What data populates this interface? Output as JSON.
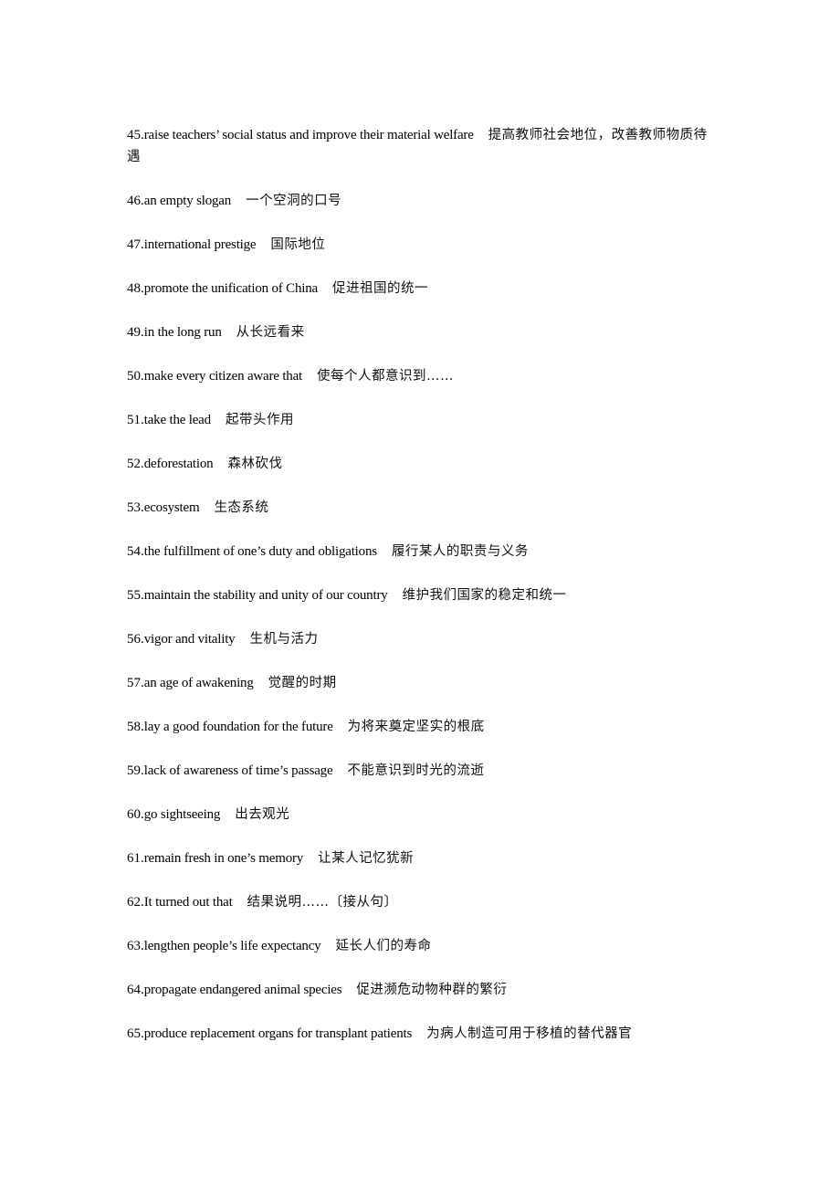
{
  "document": {
    "entries": [
      {
        "num": "45.",
        "en": "raise teachers’ social status and improve their material welfare",
        "zh": "提高教师社会地位，改善教师物质待遇"
      },
      {
        "num": "46.",
        "en": "an empty slogan",
        "zh": "一个空洞的口号"
      },
      {
        "num": "47.",
        "en": "international prestige",
        "zh": "国际地位"
      },
      {
        "num": "48.",
        "en": "promote the unification of China",
        "zh": "促进祖国的统一"
      },
      {
        "num": "49.",
        "en": "in the long run",
        "zh": "从长远看来"
      },
      {
        "num": "50.",
        "en": "make every citizen aware that",
        "zh": "使每个人都意识到……"
      },
      {
        "num": "51.",
        "en": "take the lead",
        "zh": "起带头作用"
      },
      {
        "num": "52.",
        "en": "deforestation",
        "zh": "森林砍伐"
      },
      {
        "num": "53.",
        "en": "ecosystem",
        "zh": "生态系统"
      },
      {
        "num": "54.",
        "en": "the fulfillment of one’s duty and obligations",
        "zh": "履行某人的职责与义务"
      },
      {
        "num": "55.",
        "en": "maintain the stability and unity of our country",
        "zh": "维护我们国家的稳定和统一"
      },
      {
        "num": "56.",
        "en": "vigor and vitality",
        "zh": "生机与活力"
      },
      {
        "num": "57.",
        "en": "an age of awakening",
        "zh": "觉醒的时期"
      },
      {
        "num": "58.",
        "en": "lay a good foundation for the future",
        "zh": "为将来奠定坚实的根底"
      },
      {
        "num": "59.",
        "en": "lack of awareness of time’s passage",
        "zh": "不能意识到时光的流逝"
      },
      {
        "num": "60.",
        "en": "go sightseeing",
        "zh": "出去观光"
      },
      {
        "num": "61.",
        "en": "remain fresh in one’s memory",
        "zh": "让某人记忆犹新"
      },
      {
        "num": "62.",
        "en": "It turned out that",
        "zh": "结果说明……〔接从句〕"
      },
      {
        "num": "63.",
        "en": "lengthen people’s life expectancy",
        "zh": "延长人们的寿命"
      },
      {
        "num": "64.",
        "en": "propagate endangered animal species",
        "zh": "促进濒危动物种群的繁衍"
      },
      {
        "num": "65.",
        "en": "produce replacement organs for transplant patients",
        "zh": "为病人制造可用于移植的替代器官"
      }
    ]
  }
}
